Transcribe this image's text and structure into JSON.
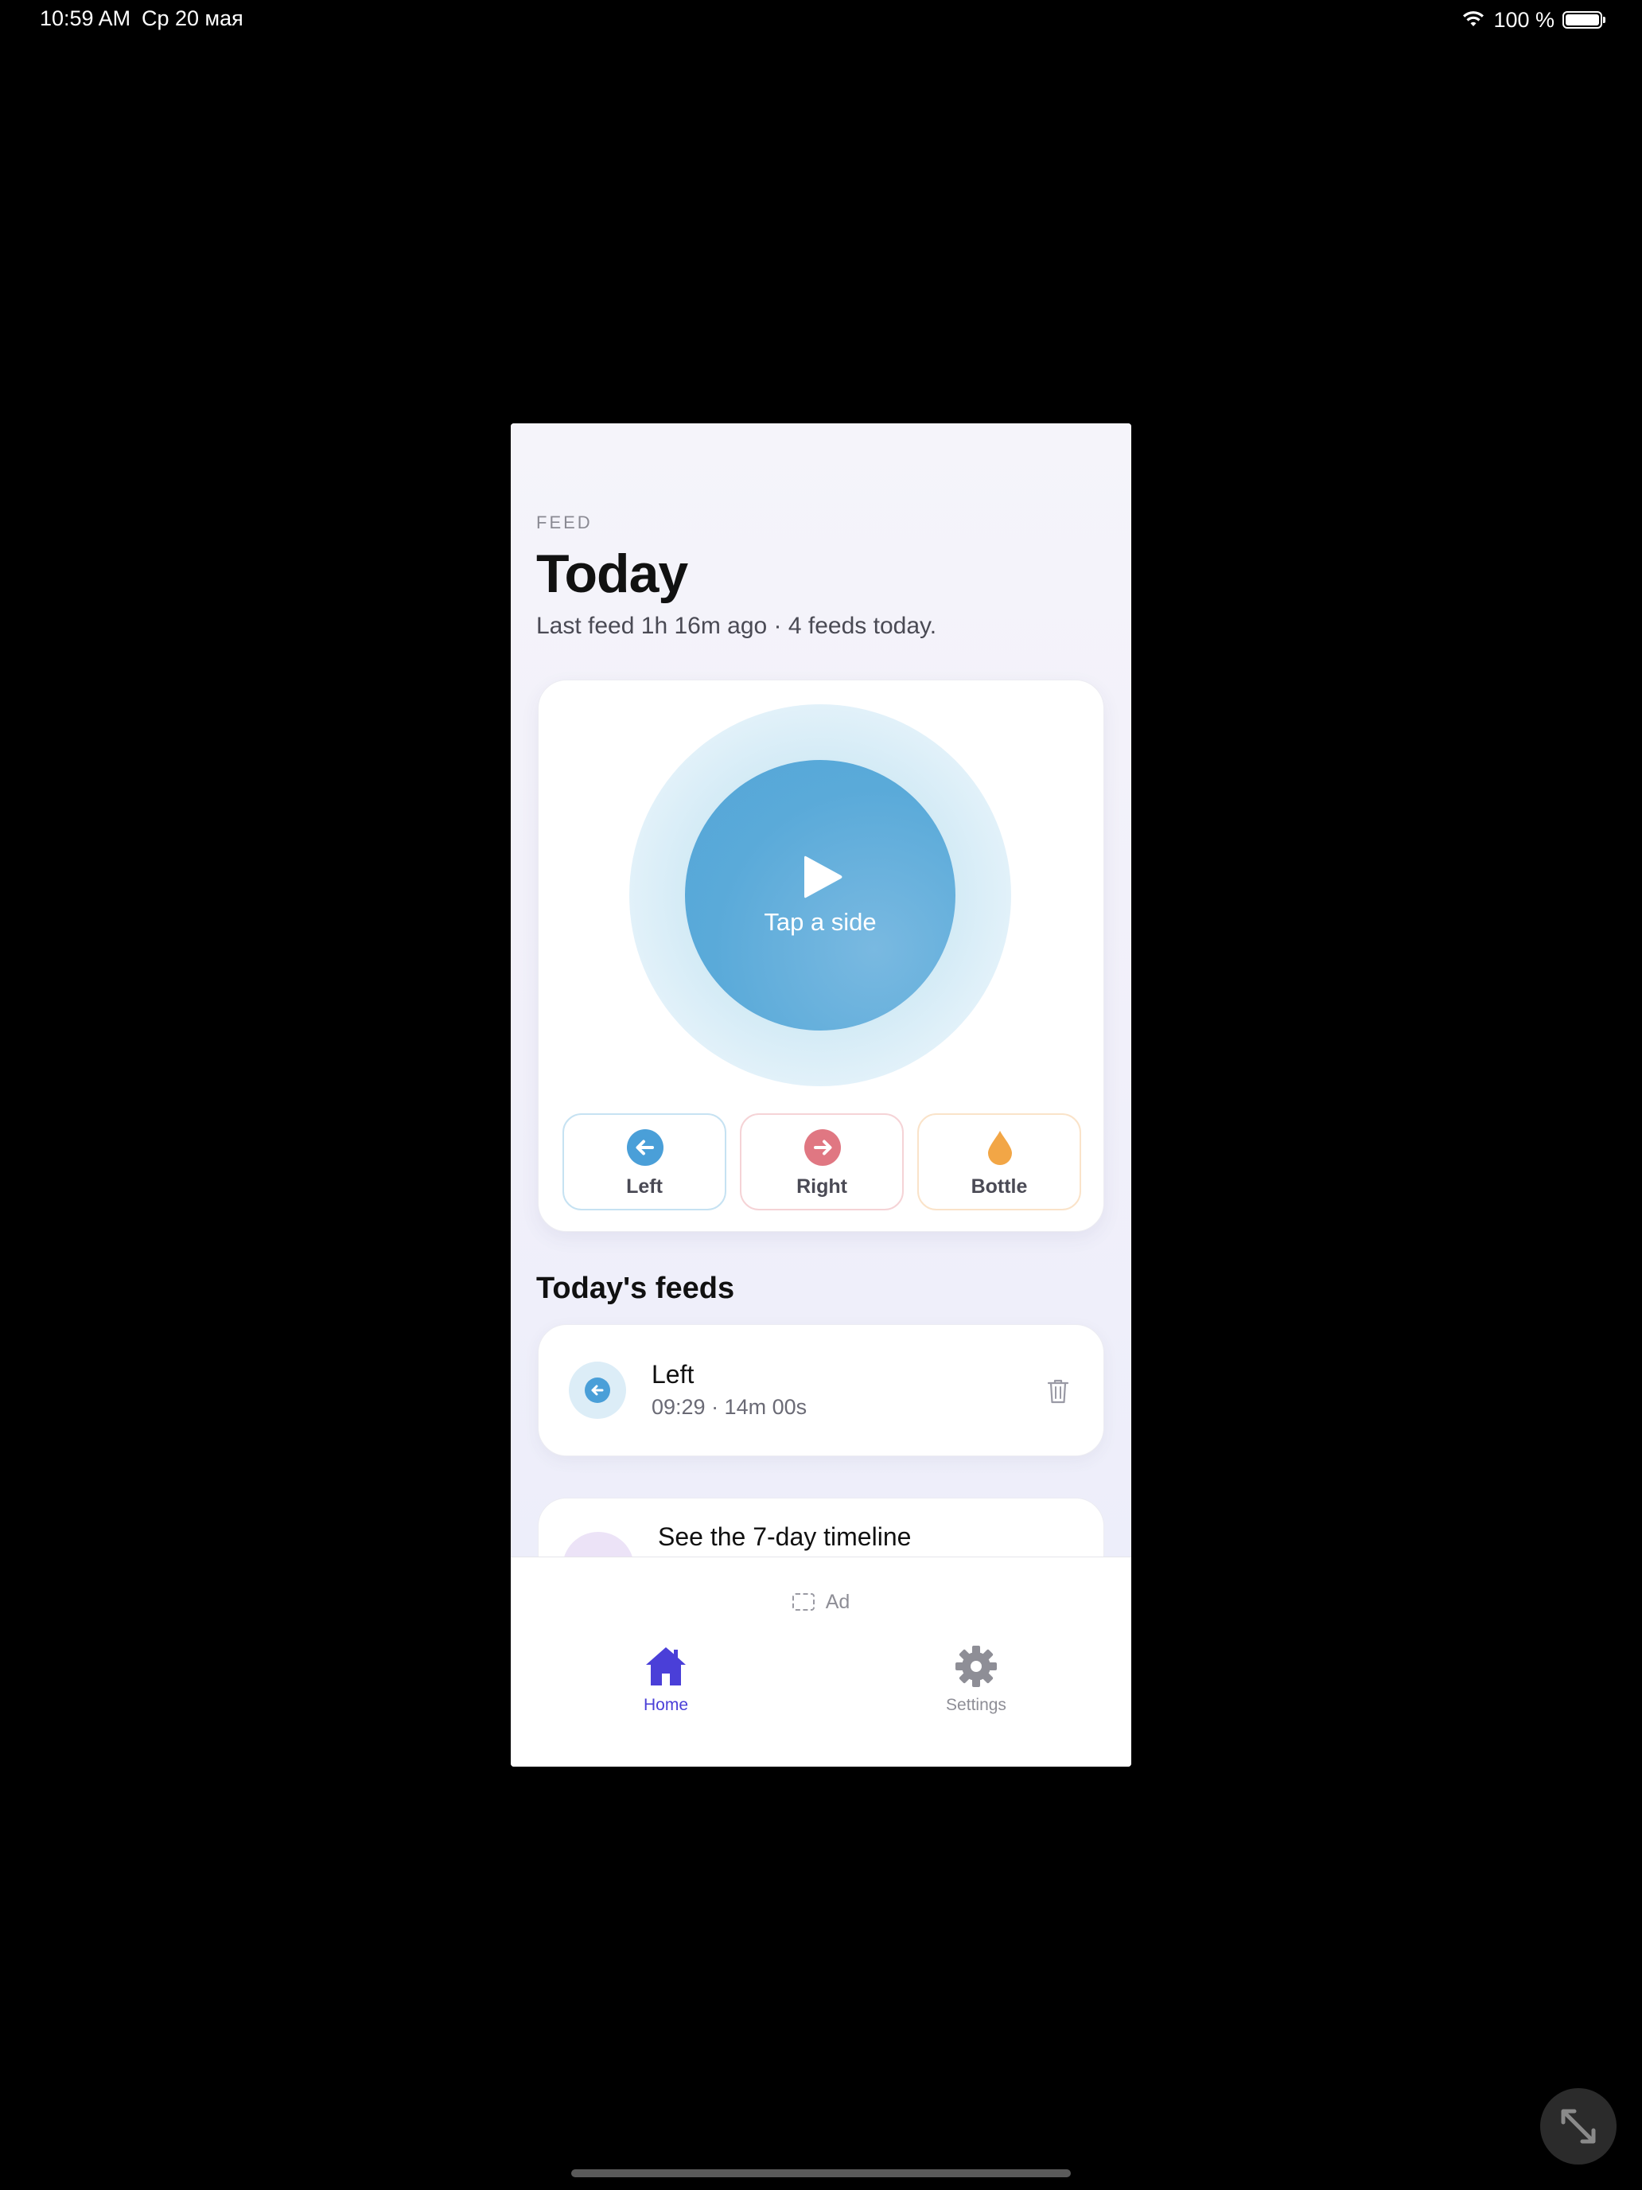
{
  "status_bar": {
    "time": "10:59 AM",
    "date": "Ср 20 мая",
    "battery": "100 %",
    "icons": [
      "wifi-icon",
      "battery-icon"
    ]
  },
  "header": {
    "eyebrow": "FEED",
    "title": "Today",
    "subtitle": "Last feed 1h 16m ago · 4 feeds today."
  },
  "start": {
    "label": "Tap a side",
    "icon": "play-icon"
  },
  "sides": [
    {
      "label": "Left",
      "icon": "arrow-left-icon",
      "color": "#4a9fd8"
    },
    {
      "label": "Right",
      "icon": "arrow-right-icon",
      "color": "#e07782"
    },
    {
      "label": "Bottle",
      "icon": "drop-icon",
      "color": "#f2a646"
    }
  ],
  "feeds_section": {
    "title": "Today's feeds",
    "items": [
      {
        "label": "Left",
        "meta": "09:29 · 14m 00s",
        "icon": "arrow-left-icon"
      }
    ]
  },
  "timeline": {
    "label": "See the 7-day timeline"
  },
  "ad": {
    "label": "Ad"
  },
  "tabs": [
    {
      "label": "Home",
      "icon": "home-icon",
      "active": true,
      "color": "#4a3fd8"
    },
    {
      "label": "Settings",
      "icon": "gear-icon",
      "active": false,
      "color": "#8e8e96"
    }
  ],
  "colors": {
    "accent_blue": "#5aaad9",
    "tab_active": "#4a3fd8"
  }
}
